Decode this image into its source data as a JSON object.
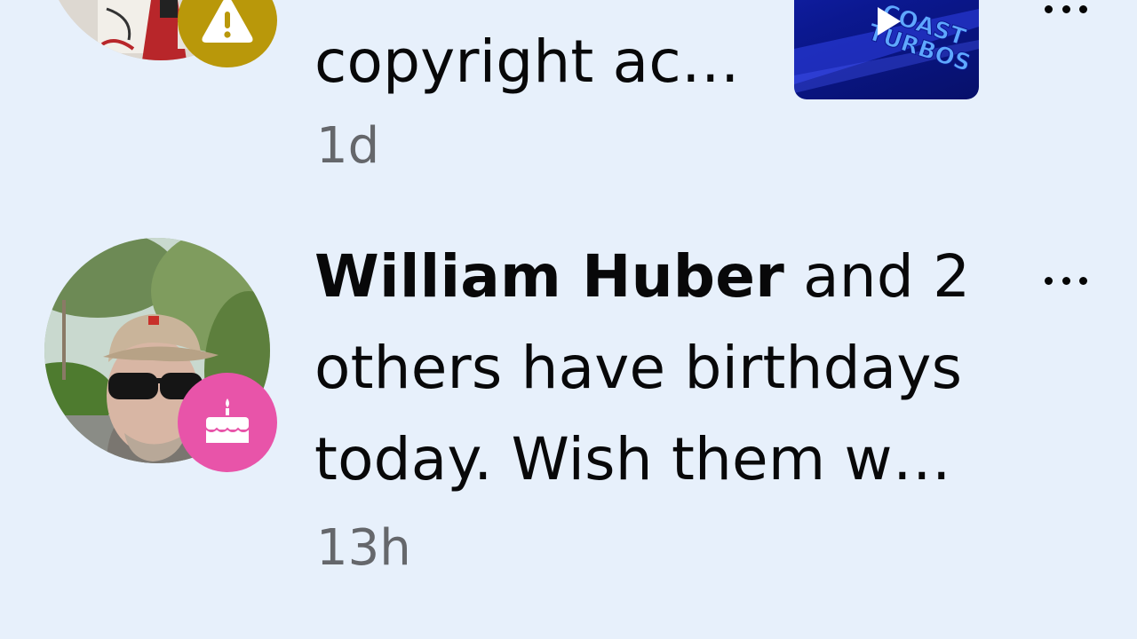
{
  "notifications": [
    {
      "text_visible": "copyright ac…",
      "time": "1d",
      "badge_icon": "warning-icon",
      "badge_color": "#b9980a",
      "thumbnail_text": "COAST TURBOS",
      "thumbnail_icon": "play-icon",
      "more_icon": "more-icon"
    },
    {
      "name": "William Huber",
      "text": " and 2 others have birthdays today. Wish them w…",
      "time": "13h",
      "badge_icon": "cake-icon",
      "badge_color": "#e854a9",
      "more_icon": "more-icon"
    }
  ],
  "colors": {
    "background": "#e7f0fb",
    "text": "#080809",
    "secondary_text": "#65676b"
  }
}
